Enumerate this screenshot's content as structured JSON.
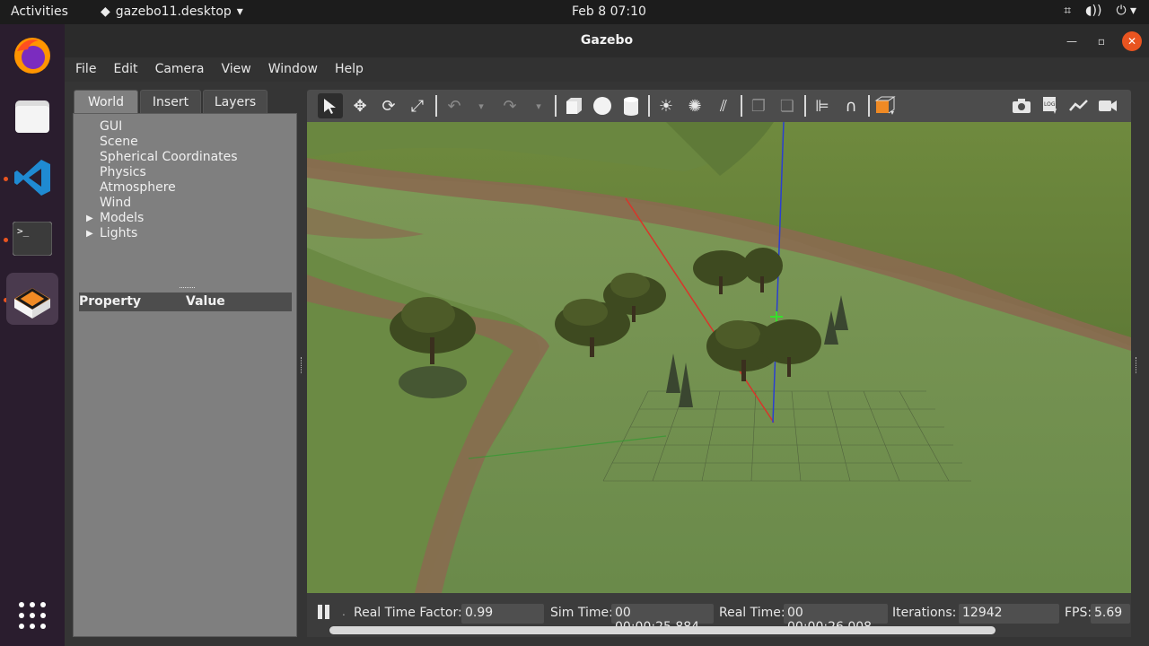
{
  "topbar": {
    "activities": "Activities",
    "app_name": "gazebo11.desktop",
    "clock": "Feb 8  07:10"
  },
  "window": {
    "title": "Gazebo"
  },
  "menu": [
    "File",
    "Edit",
    "Camera",
    "View",
    "Window",
    "Help"
  ],
  "left_panel": {
    "tabs": [
      "World",
      "Insert",
      "Layers"
    ],
    "tree": [
      "GUI",
      "Scene",
      "Spherical Coordinates",
      "Physics",
      "Atmosphere",
      "Wind",
      "Models",
      "Lights"
    ],
    "property_header": "Property",
    "value_header": "Value"
  },
  "statusbar": {
    "rtf_label": "Real Time Factor:",
    "rtf_value": "0.99",
    "sim_time_label": "Sim Time:",
    "sim_time_value": "00 00:00:25.884",
    "real_time_label": "Real Time:",
    "real_time_value": "00 00:00:26.008",
    "iterations_label": "Iterations:",
    "iterations_value": "12942",
    "fps_label": "FPS:",
    "fps_value": "5.69"
  },
  "icons": {
    "dock": [
      "firefox-icon",
      "files-icon",
      "vscode-icon",
      "terminal-icon",
      "gazebo-icon",
      "app-grid-icon"
    ],
    "toolbar": [
      "select-icon",
      "translate-icon",
      "rotate-icon",
      "scale-icon",
      "undo-icon",
      "redo-icon",
      "box-icon",
      "sphere-icon",
      "cylinder-icon",
      "point-light-icon",
      "spot-light-icon",
      "directional-light-icon",
      "copy-icon",
      "paste-icon",
      "align-icon",
      "snap-icon",
      "view-angle-icon",
      "screenshot-icon",
      "log-icon",
      "plot-icon",
      "record-icon"
    ]
  },
  "colors": {
    "accent": "#e95420",
    "dock_bg": "#2a1d2e",
    "panel_bg": "#7f7f7f"
  }
}
